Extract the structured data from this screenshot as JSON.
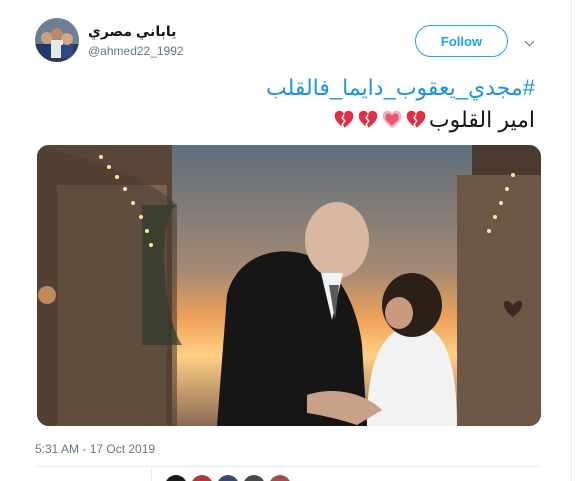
{
  "tweet": {
    "display_name": "ياباني مصري",
    "handle": "@ahmed22_1992",
    "follow_label": "Follow",
    "hashtag": "#مجدي_يعقوب_دايما_فالقلب",
    "text": "امير القلوب",
    "hearts": [
      "broken-heart-icon",
      "sparkling-heart-icon",
      "broken-heart-icon",
      "broken-heart-icon"
    ],
    "timestamp": "5:31 AM - 17 Oct 2019"
  },
  "colors": {
    "accent": "#1da1f2",
    "hashtag": "#1b95e0",
    "broken_heart": "#dd2e44",
    "sparkling_heart": "#f4abba"
  }
}
